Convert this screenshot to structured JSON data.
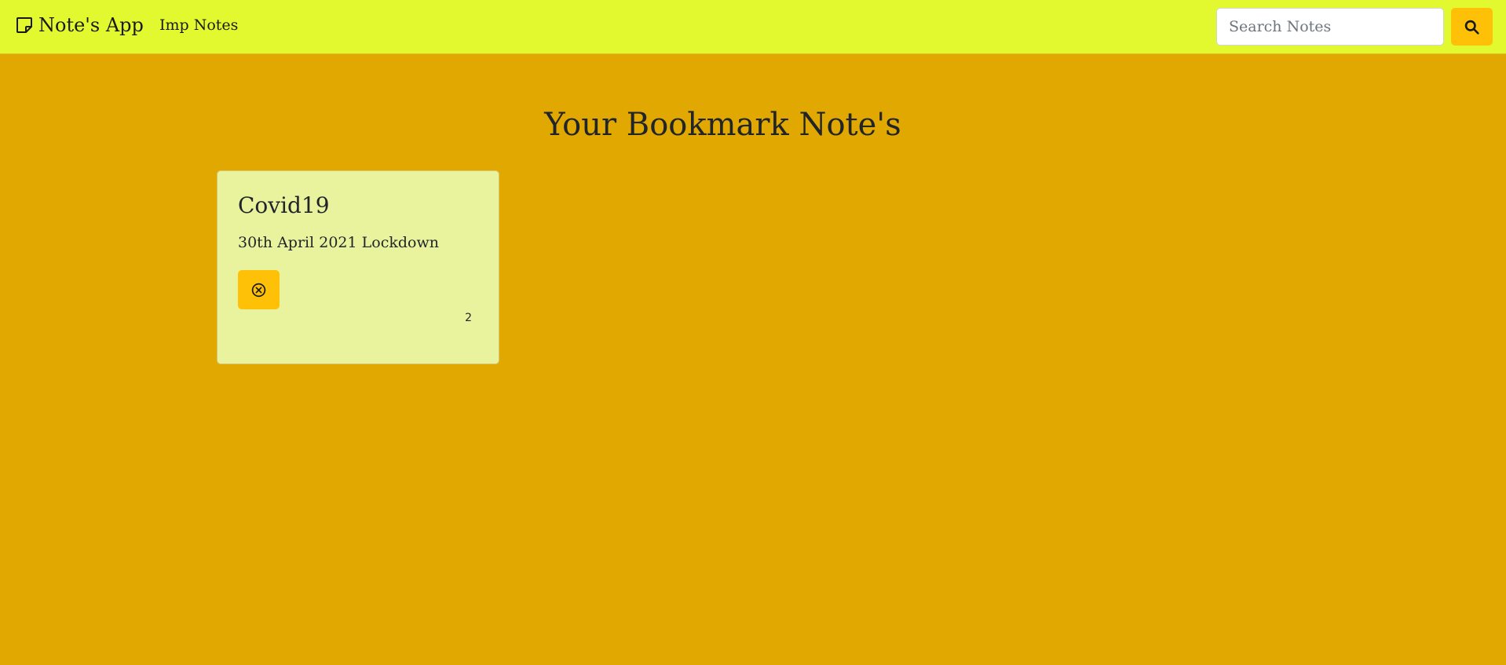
{
  "navbar": {
    "brand_icon": "sticky-note-icon",
    "brand_label": "Note's App",
    "link_label": "Imp Notes",
    "search_placeholder": "Search Notes",
    "search_icon": "search-icon"
  },
  "main": {
    "title": "Your Bookmark Note's",
    "notes": [
      {
        "title": "Covid19",
        "body": "30th April 2021 Lockdown",
        "delete_icon": "x-circle-icon",
        "id": "2"
      }
    ]
  },
  "colors": {
    "navbar_bg": "#e3f92f",
    "page_bg": "#e0a800",
    "card_bg": "#e9f39e",
    "button_bg": "#ffc107"
  }
}
